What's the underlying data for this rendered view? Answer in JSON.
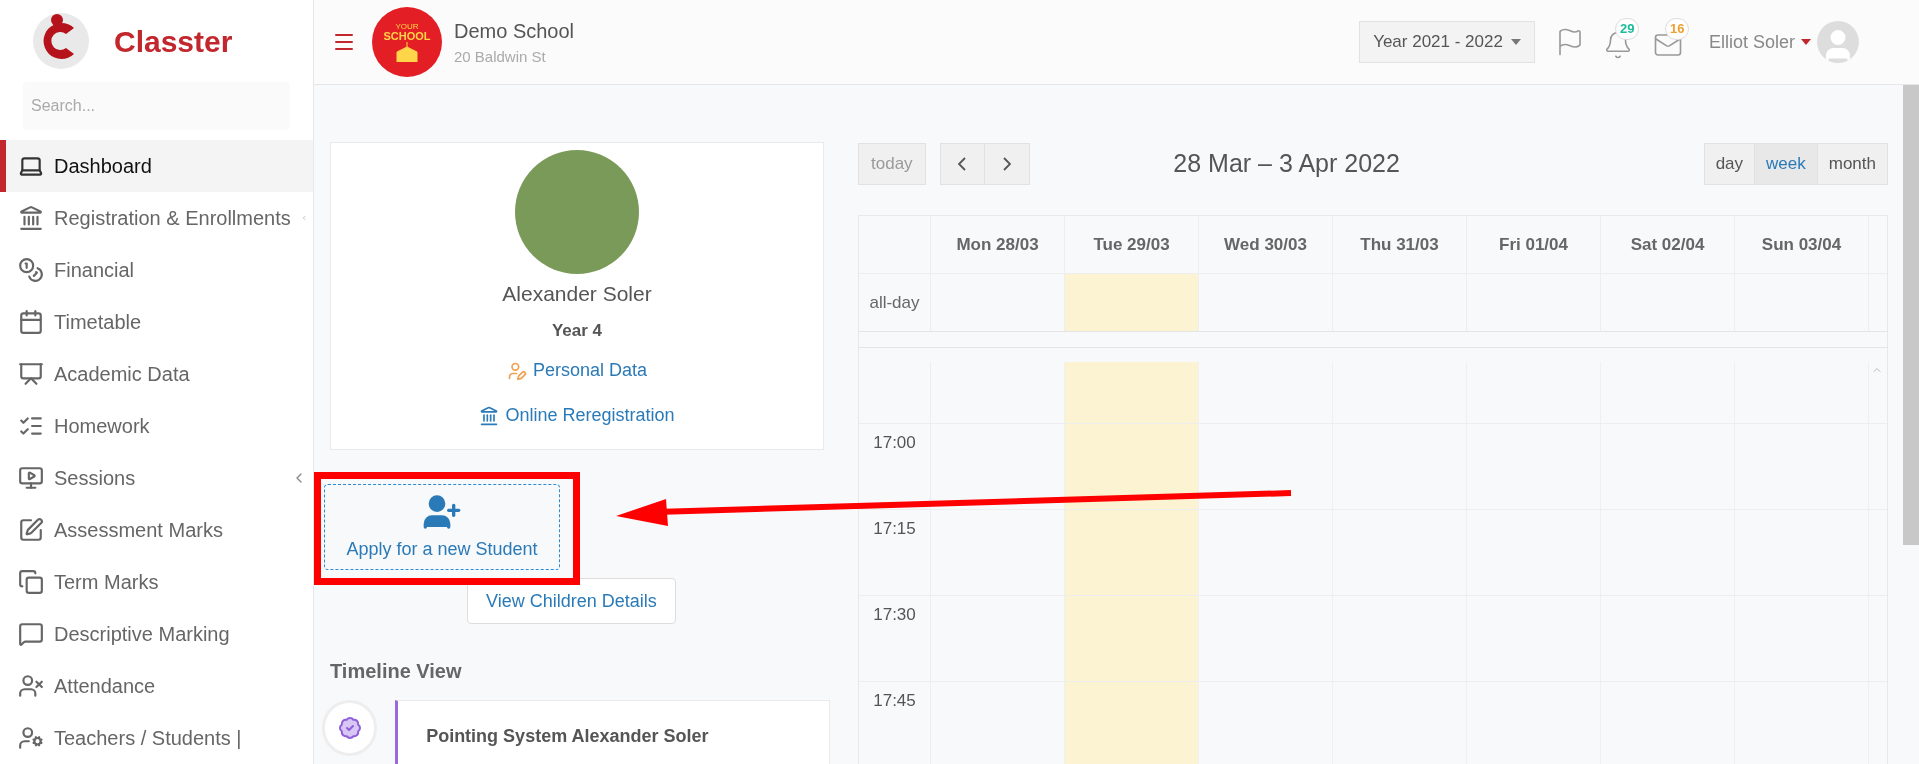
{
  "brand": {
    "name": "Classter"
  },
  "sidebar": {
    "search": {
      "placeholder": "Search..."
    },
    "items": [
      {
        "label": "Dashboard",
        "kind": "laptop",
        "selected": true,
        "has_submenu": false
      },
      {
        "label": "Registration & Enrollments",
        "kind": "bank",
        "selected": false,
        "has_submenu": true
      },
      {
        "label": "Financial",
        "kind": "coins",
        "selected": false,
        "has_submenu": false
      },
      {
        "label": "Timetable",
        "kind": "calendar",
        "selected": false,
        "has_submenu": false
      },
      {
        "label": "Academic Data",
        "kind": "board",
        "selected": false,
        "has_submenu": false
      },
      {
        "label": "Homework",
        "kind": "checklist",
        "selected": false,
        "has_submenu": false
      },
      {
        "label": "Sessions",
        "kind": "presenter",
        "selected": false,
        "has_submenu": true
      },
      {
        "label": "Assessment Marks",
        "kind": "edit",
        "selected": false,
        "has_submenu": false
      },
      {
        "label": "Term Marks",
        "kind": "copy",
        "selected": false,
        "has_submenu": false
      },
      {
        "label": "Descriptive Marking",
        "kind": "comment",
        "selected": false,
        "has_submenu": false
      },
      {
        "label": "Attendance",
        "kind": "userx",
        "selected": false,
        "has_submenu": false
      },
      {
        "label": "Teachers / Students |",
        "kind": "userclock",
        "selected": false,
        "has_submenu": false
      }
    ]
  },
  "header": {
    "school": {
      "logo_text": [
        "YOUR",
        "SCHOOL"
      ],
      "name": "Demo School",
      "address": "20 Baldwin St"
    },
    "year": "Year 2021 - 2022",
    "notifications": [
      {
        "kind": "bell",
        "count": "29",
        "color": "#1abc9c"
      },
      {
        "kind": "mail",
        "count": "16",
        "color": "#f0a030"
      }
    ],
    "user": "Elliot Soler"
  },
  "student": {
    "name": "Alexander Soler",
    "grade": "Year 4",
    "links": [
      {
        "kind": "person",
        "label": "Personal Data"
      },
      {
        "kind": "bank",
        "label": "Online Reregistration"
      }
    ]
  },
  "apply_button": "Apply for a new Student",
  "view_children_button": "View Children Details",
  "timeline": {
    "title": "Timeline View",
    "entries": [
      {
        "title": "Pointing System Alexander Soler"
      }
    ]
  },
  "calendar": {
    "today_button": "today",
    "title": "28 Mar – 3 Apr 2022",
    "views": [
      {
        "label": "day",
        "selected": false
      },
      {
        "label": "week",
        "selected": true
      },
      {
        "label": "month",
        "selected": false
      }
    ],
    "days": [
      {
        "label": "Mon 28/03",
        "today": false
      },
      {
        "label": "Tue 29/03",
        "today": true
      },
      {
        "label": "Wed 30/03",
        "today": false
      },
      {
        "label": "Thu 31/03",
        "today": false
      },
      {
        "label": "Fri 01/04",
        "today": false
      },
      {
        "label": "Sat 02/04",
        "today": false
      },
      {
        "label": "Sun 03/04",
        "today": false
      }
    ],
    "all_day_label": "all-day",
    "times": [
      "17:00",
      "17:15",
      "17:30",
      "17:45"
    ]
  }
}
